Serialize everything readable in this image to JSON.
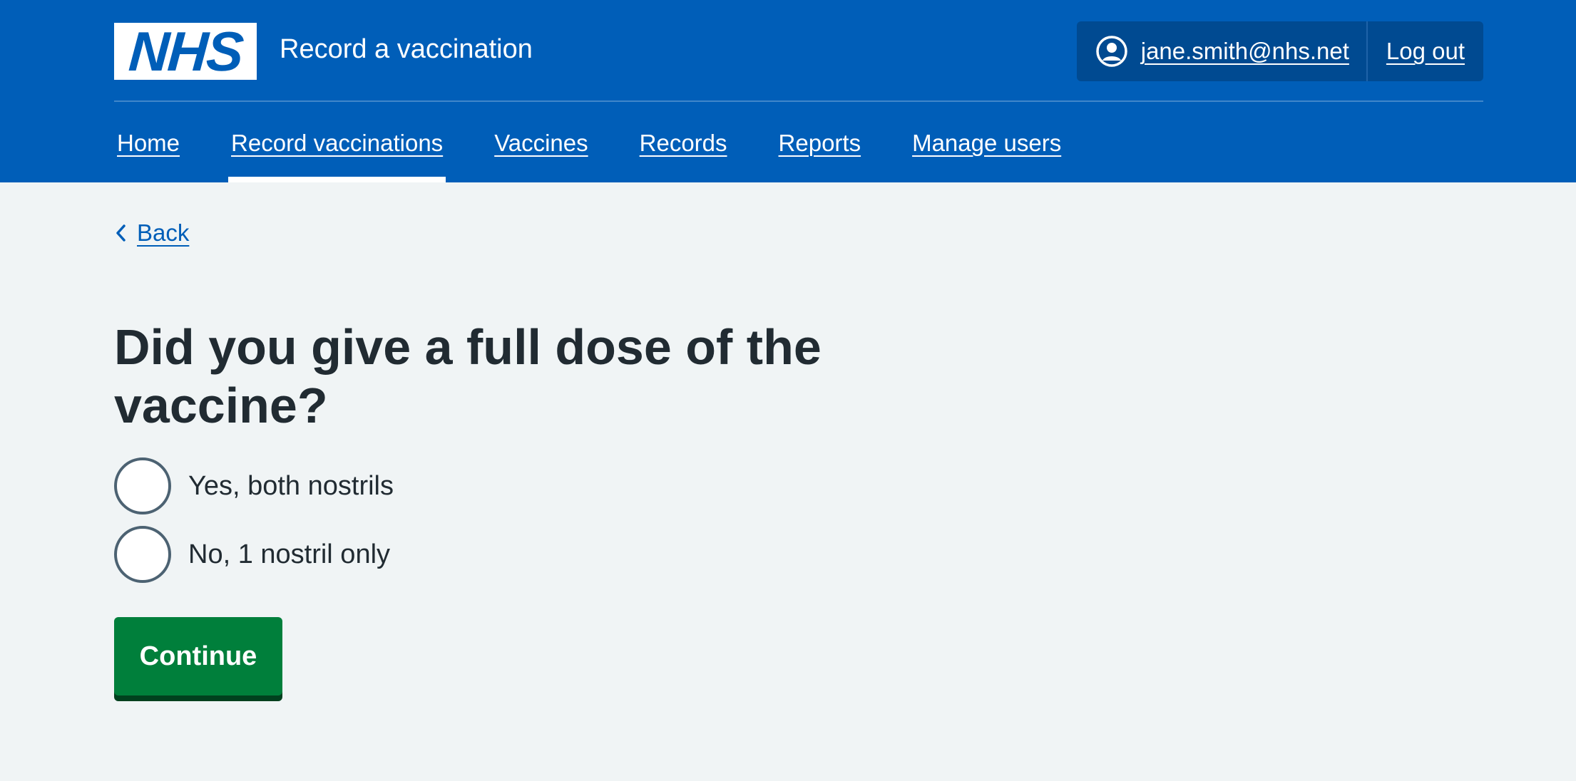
{
  "header": {
    "logo_text": "NHS",
    "service_name": "Record a vaccination",
    "account": {
      "user_icon": "user-circle-icon",
      "email": "jane.smith@nhs.net",
      "logout_label": "Log out"
    },
    "nav": {
      "items": [
        {
          "label": "Home",
          "active": false
        },
        {
          "label": "Record vaccinations",
          "active": true
        },
        {
          "label": "Vaccines",
          "active": false
        },
        {
          "label": "Records",
          "active": false
        },
        {
          "label": "Reports",
          "active": false
        },
        {
          "label": "Manage users",
          "active": false
        }
      ]
    }
  },
  "main": {
    "back": {
      "icon": "chevron-left-icon",
      "label": "Back"
    },
    "question": "Did you give a full dose of the vaccine?",
    "options": [
      {
        "label": "Yes, both nostrils",
        "selected": false
      },
      {
        "label": "No, 1 nostril only",
        "selected": false
      }
    ],
    "continue_label": "Continue"
  },
  "colors": {
    "header_bg": "#005eb8",
    "account_bg": "#004a91",
    "page_bg": "#f0f4f5",
    "text": "#212b32",
    "link": "#005eb8",
    "button_green": "#007f3b",
    "button_shadow": "#00401e",
    "radio_border": "#4c6272"
  }
}
